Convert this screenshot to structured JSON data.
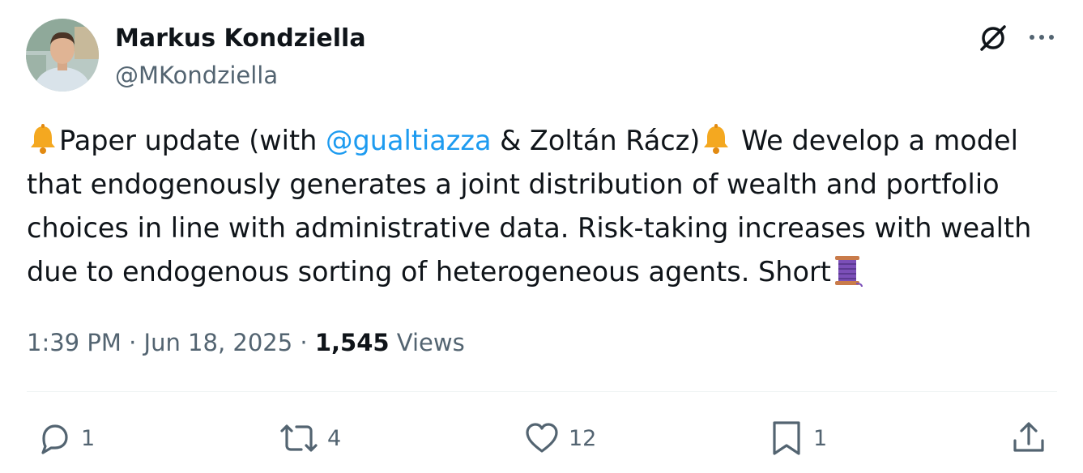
{
  "author": {
    "name": "Markus Kondziella",
    "handle": "@MKondziella"
  },
  "tweet": {
    "lines": [
      {
        "pre": "Paper update (with ",
        "mention": "@gualtiazza",
        "post": " & Zoltán Rácz)",
        "tail": " We develop a model"
      },
      {
        "text": "that endogenously generates a joint distribution of wealth and portfolio"
      },
      {
        "text": "choices in line with administrative data. Risk-taking increases with wealth"
      },
      {
        "text": "due to endogenous sorting of heterogeneous agents. Short"
      }
    ],
    "emojis": [
      "bell-emoji",
      "bell-emoji",
      "thread-spool-emoji"
    ]
  },
  "meta": {
    "time": "1:39 PM",
    "separator": "·",
    "date": "Jun 18, 2025",
    "views_count": "1,545",
    "views_label": "Views"
  },
  "actions": {
    "reply": {
      "icon": "reply-icon",
      "count": "1"
    },
    "repost": {
      "icon": "repost-icon",
      "count": "4"
    },
    "like": {
      "icon": "heart-icon",
      "count": "12"
    },
    "bookmark": {
      "icon": "bookmark-icon",
      "count": "1"
    },
    "share": {
      "icon": "share-icon"
    }
  },
  "header_icons": [
    "grok-icon",
    "more-icon"
  ],
  "colors": {
    "text": "#0f1419",
    "secondary": "#536471",
    "link": "#1d9bf0",
    "divider": "#eff3f4"
  }
}
